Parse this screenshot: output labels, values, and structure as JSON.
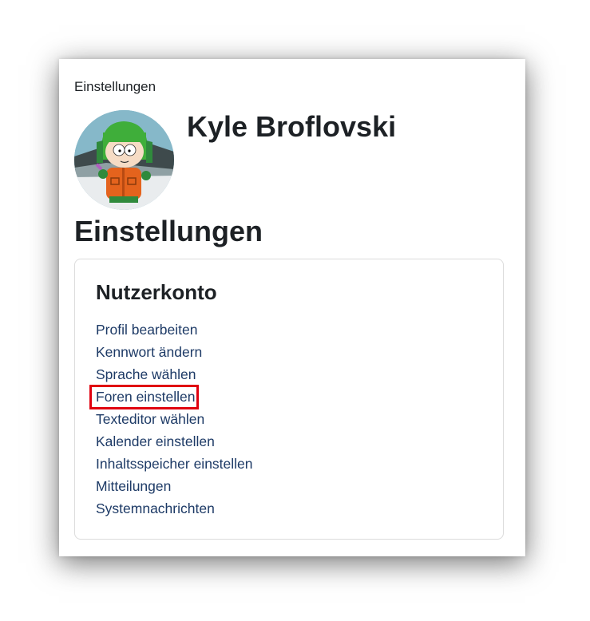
{
  "breadcrumb": "Einstellungen",
  "user": {
    "name": "Kyle Broflovski",
    "avatar_icon": "user-avatar-kyle"
  },
  "page_title": "Einstellungen",
  "account_section": {
    "title": "Nutzerkonto",
    "links": [
      {
        "label": "Profil bearbeiten",
        "highlighted": false
      },
      {
        "label": "Kennwort ändern",
        "highlighted": false
      },
      {
        "label": "Sprache wählen",
        "highlighted": false
      },
      {
        "label": "Foren einstellen",
        "highlighted": true
      },
      {
        "label": "Texteditor wählen",
        "highlighted": false
      },
      {
        "label": "Kalender einstellen",
        "highlighted": false
      },
      {
        "label": "Inhaltsspeicher einstellen",
        "highlighted": false
      },
      {
        "label": "Mitteilungen",
        "highlighted": false
      },
      {
        "label": "Systemnachrichten",
        "highlighted": false
      }
    ]
  },
  "colors": {
    "link": "#1d3a66",
    "highlight_box": "#e0000f",
    "text": "#1d2125"
  }
}
